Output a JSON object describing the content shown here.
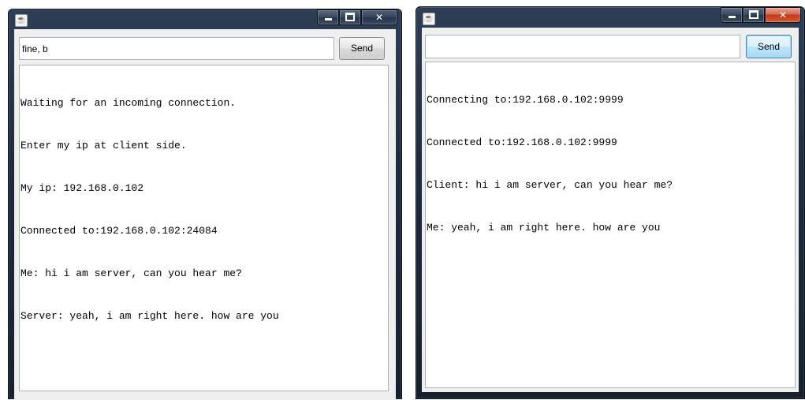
{
  "left_window": {
    "app_icon": "java-cup-icon",
    "controls": {
      "minimize": "minimize-icon",
      "maximize": "maximize-icon",
      "close": "close-icon"
    },
    "message_input": {
      "value": "fine, b"
    },
    "send_button": {
      "label": "Send"
    },
    "chat_log": [
      "Waiting for an incoming connection.",
      "Enter my ip at client side.",
      "My ip: 192.168.0.102",
      "Connected to:192.168.0.102:24084",
      "Me: hi i am server, can you hear me?",
      "Server: yeah, i am right here. how are you"
    ]
  },
  "right_window": {
    "app_icon": "java-cup-icon",
    "controls": {
      "minimize": "minimize-icon",
      "maximize": "maximize-icon",
      "close": "close-icon"
    },
    "message_input": {
      "value": ""
    },
    "send_button": {
      "label": "Send"
    },
    "chat_log": [
      "Connecting to:192.168.0.102:9999",
      "Connected to:192.168.0.102:9999",
      "Client: hi i am server, can you hear me?",
      "Me: yeah, i am right here. how are you"
    ]
  },
  "colors": {
    "title_bar": "#1f2c3f",
    "close_active": "#c0391b",
    "client_bg": "#efefef",
    "focus_blue": "#3c7fb1"
  }
}
